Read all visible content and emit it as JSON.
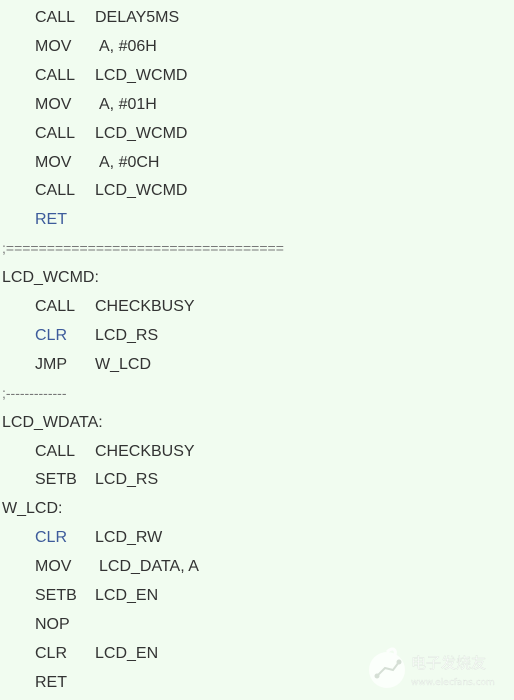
{
  "code": [
    {
      "type": "instr",
      "mnemonic": "CALL",
      "operand": "DELAY5MS",
      "blue": false
    },
    {
      "type": "instr",
      "mnemonic": "MOV",
      "operand": "A, #06H",
      "blue": false
    },
    {
      "type": "instr",
      "mnemonic": "CALL",
      "operand": "LCD_WCMD",
      "blue": false
    },
    {
      "type": "instr",
      "mnemonic": "MOV",
      "operand": "A, #01H",
      "blue": false
    },
    {
      "type": "instr",
      "mnemonic": "CALL",
      "operand": "LCD_WCMD",
      "blue": false
    },
    {
      "type": "instr",
      "mnemonic": "MOV",
      "operand": "A, #0CH",
      "blue": false
    },
    {
      "type": "instr",
      "mnemonic": "CALL",
      "operand": "LCD_WCMD",
      "blue": false
    },
    {
      "type": "instr",
      "mnemonic": "RET",
      "operand": "",
      "blue": true
    },
    {
      "type": "sep",
      "text": ";=================================="
    },
    {
      "type": "label",
      "text": "LCD_WCMD:"
    },
    {
      "type": "instr",
      "mnemonic": "CALL",
      "operand": "CHECKBUSY",
      "blue": false
    },
    {
      "type": "instr",
      "mnemonic": "CLR",
      "operand": "LCD_RS",
      "blue": true
    },
    {
      "type": "instr",
      "mnemonic": "JMP",
      "operand": "W_LCD",
      "blue": false
    },
    {
      "type": "sep",
      "text": ";-------------"
    },
    {
      "type": "label",
      "text": "LCD_WDATA:"
    },
    {
      "type": "instr",
      "mnemonic": "CALL",
      "operand": "CHECKBUSY",
      "blue": false
    },
    {
      "type": "instr",
      "mnemonic": "SETB",
      "operand": "LCD_RS",
      "blue": false
    },
    {
      "type": "label",
      "text": "W_LCD:"
    },
    {
      "type": "instr",
      "mnemonic": "CLR",
      "operand": "LCD_RW",
      "blue": true
    },
    {
      "type": "instr",
      "mnemonic": "MOV",
      "operand": "LCD_DATA, A",
      "blue": false
    },
    {
      "type": "instr",
      "mnemonic": "SETB",
      "operand": "LCD_EN",
      "blue": false
    },
    {
      "type": "instr",
      "mnemonic": "NOP",
      "operand": "",
      "blue": false
    },
    {
      "type": "instr",
      "mnemonic": "CLR",
      "operand": "LCD_EN",
      "blue": false
    },
    {
      "type": "instr",
      "mnemonic": "RET",
      "operand": "",
      "blue": false
    }
  ],
  "watermark": {
    "brand": "电子发烧友",
    "url": "www.elecfans.com"
  },
  "colors": {
    "background": "#f1fcf0",
    "text": "#333333",
    "keyword_blue": "#3d5b9b"
  }
}
